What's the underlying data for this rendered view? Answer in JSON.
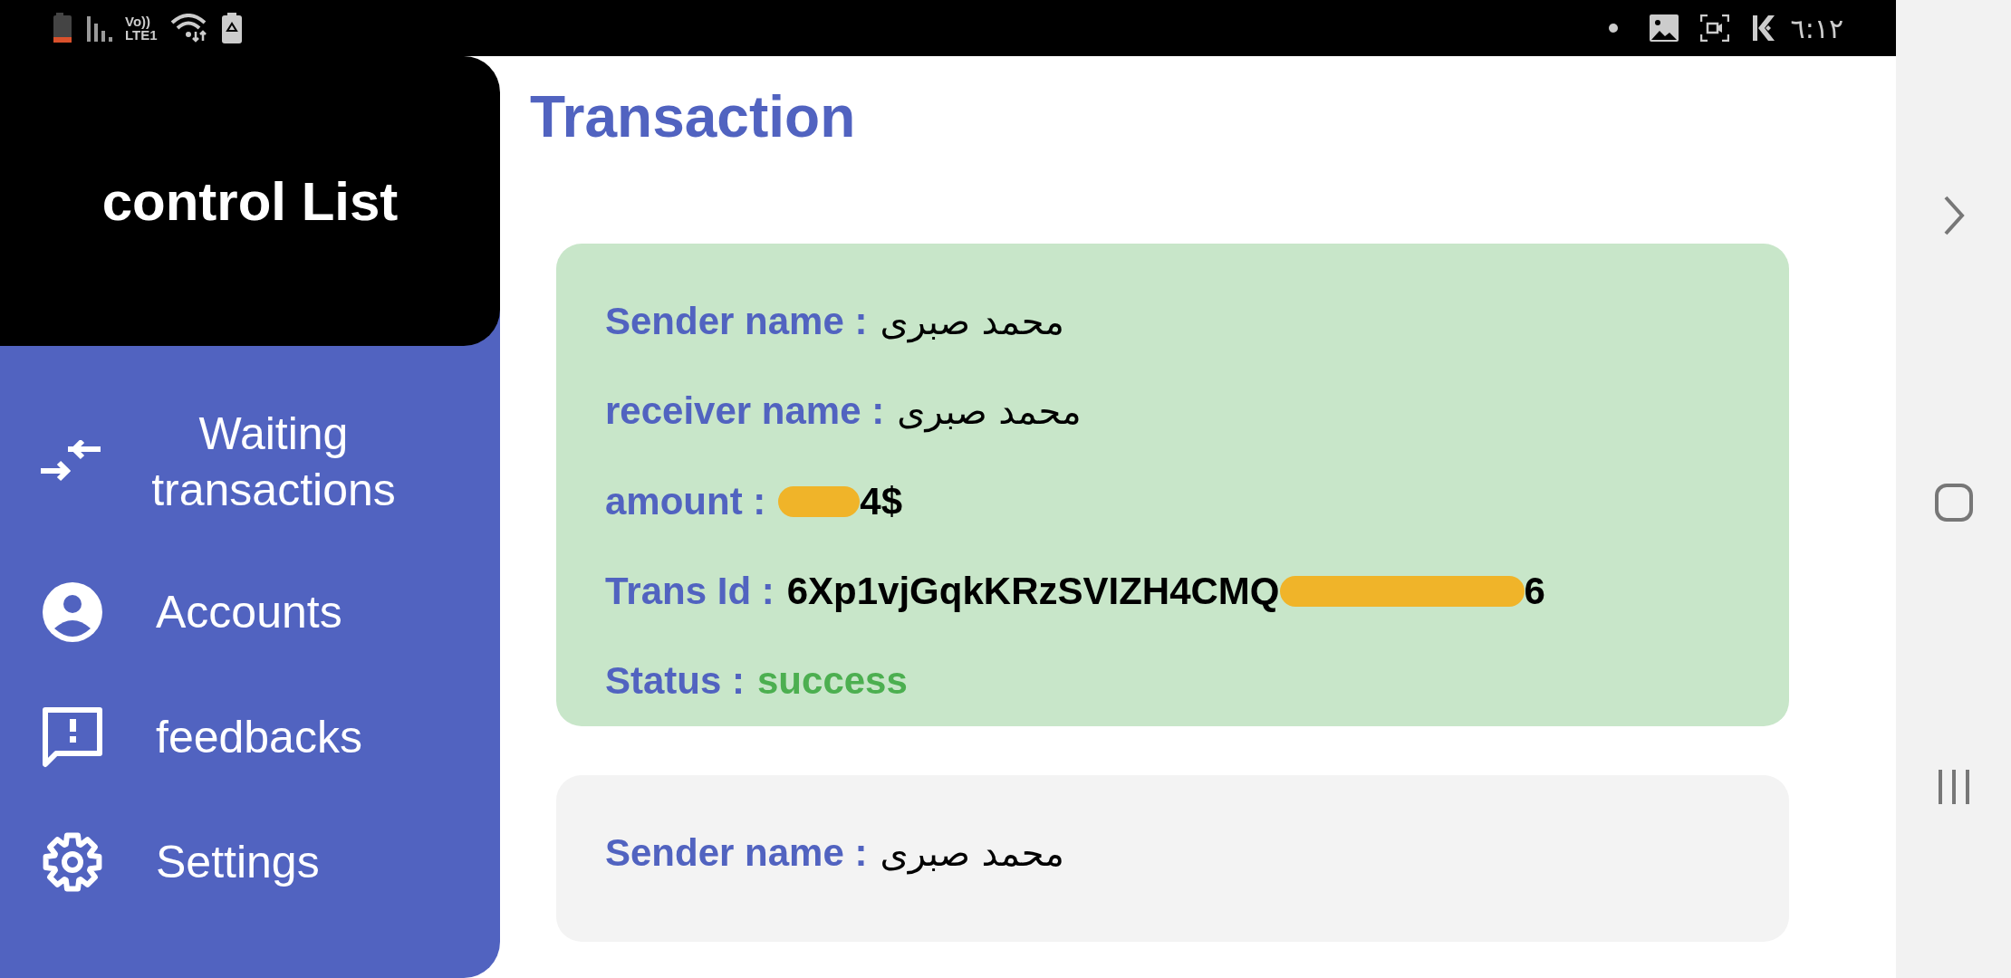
{
  "status_bar": {
    "network_top": "Vo))",
    "network_bottom": "LTE1",
    "time": "٦:١٢"
  },
  "drawer": {
    "title": "control List",
    "items": [
      {
        "label": "Waiting transactions"
      },
      {
        "label": "Accounts"
      },
      {
        "label": "feedbacks"
      },
      {
        "label": "Settings"
      }
    ]
  },
  "page": {
    "title": "Transaction"
  },
  "cards": [
    {
      "color": "#c8e6c9",
      "rows": [
        {
          "kind": "text",
          "label": "Sender name :",
          "value": "محمد صبرى"
        },
        {
          "kind": "text",
          "label": "receiver name :",
          "value": "محمد صبرى"
        },
        {
          "kind": "redacted",
          "label": "amount :",
          "after": "4$"
        },
        {
          "kind": "redacted",
          "label": "Trans Id :",
          "before": "6Xp1vjGqkKRzSVIZH4CMQ",
          "after": "6"
        },
        {
          "kind": "status",
          "label": "Status :",
          "value": "success"
        }
      ]
    },
    {
      "color": "#f3f3f3",
      "rows": [
        {
          "kind": "text",
          "label": "Sender name :",
          "value": "محمد صبرى"
        }
      ]
    }
  ]
}
